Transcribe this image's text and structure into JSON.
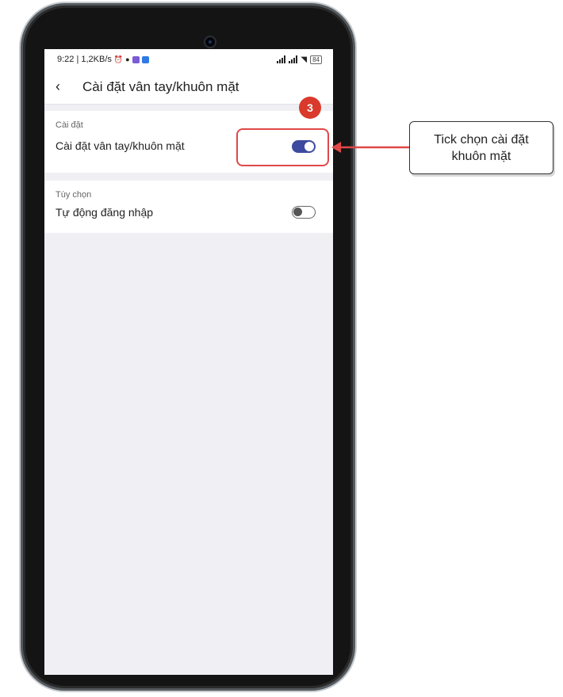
{
  "status_bar": {
    "time_info": "9:22 | 1,2KB/s",
    "battery": "84",
    "icons": [
      "alarm-icon",
      "bear-icon",
      "viber-icon",
      "messenger-icon",
      "signal-icon",
      "signal-icon",
      "wifi-icon",
      "battery-icon"
    ]
  },
  "app_bar": {
    "back_icon": "‹",
    "title": "Cài đặt vân tay/khuôn mặt"
  },
  "sections": [
    {
      "header": "Cài đặt",
      "label": "Cài đặt vân tay/khuôn mặt",
      "toggle_on": true
    },
    {
      "header": "Tùy chọn",
      "label": "Tự động đăng nhập",
      "toggle_on": false
    }
  ],
  "annotation": {
    "step": "3",
    "callout_text": "Tick chọn cài đặt khuôn mặt",
    "accent_color": "#e04848",
    "toggle_on_color": "#3e4aa0"
  }
}
